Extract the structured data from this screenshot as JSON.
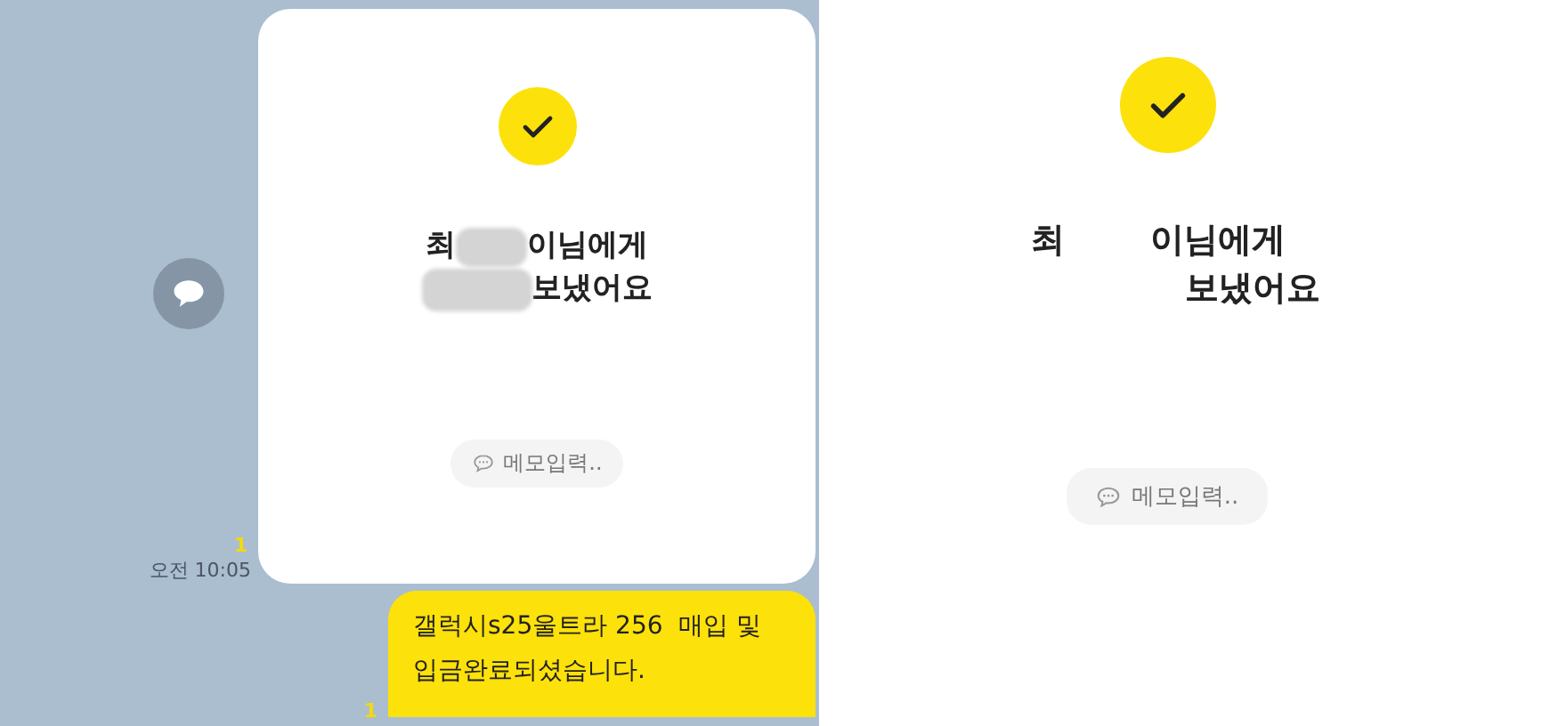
{
  "chat": {
    "transfer_card": {
      "recipient_start": "최",
      "recipient_end": "이님에게",
      "action": "보냈어요",
      "memo_label": "메모입력.."
    },
    "card_read_count": "1",
    "card_time": "오전 10:05",
    "message": {
      "text": "갤럭시s25울트라 256  매입 및\n입금완료되셨습니다.",
      "read_count": "1"
    }
  },
  "confirmation": {
    "recipient_start": "최",
    "recipient_end": "이님에게",
    "action": "보냈어요",
    "memo_label": "메모입력.."
  }
}
